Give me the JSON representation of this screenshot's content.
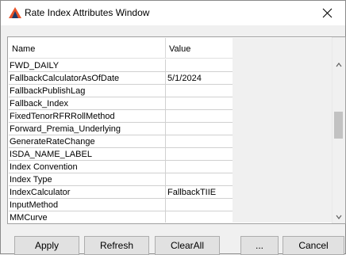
{
  "window": {
    "title": "Rate Index Attributes Window",
    "app_icon": "triangle-logo-icon",
    "close_icon": "close-icon"
  },
  "grid": {
    "columns": [
      "Name",
      "Value"
    ],
    "rows": [
      {
        "name": "FWD_DAILY",
        "value": ""
      },
      {
        "name": "FallbackCalculatorAsOfDate",
        "value": "5/1/2024"
      },
      {
        "name": "FallbackPublishLag",
        "value": ""
      },
      {
        "name": "Fallback_Index",
        "value": ""
      },
      {
        "name": "FixedTenorRFRRollMethod",
        "value": ""
      },
      {
        "name": "Forward_Premia_Underlying",
        "value": ""
      },
      {
        "name": "GenerateRateChange",
        "value": ""
      },
      {
        "name": "ISDA_NAME_LABEL",
        "value": ""
      },
      {
        "name": "Index Convention",
        "value": ""
      },
      {
        "name": "Index Type",
        "value": ""
      },
      {
        "name": "IndexCalculator",
        "value": "FallbackTIIE"
      },
      {
        "name": "InputMethod",
        "value": ""
      },
      {
        "name": "MMCurve",
        "value": ""
      }
    ]
  },
  "buttons": {
    "apply": "Apply",
    "refresh": "Refresh",
    "clearall": "ClearAll",
    "dots": "...",
    "cancel": "Cancel"
  }
}
